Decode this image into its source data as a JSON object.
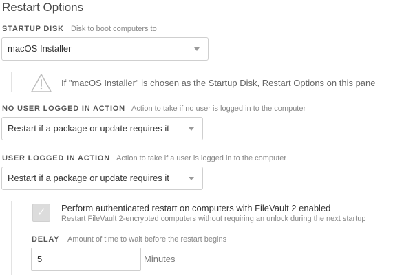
{
  "page": {
    "title": "Restart Options"
  },
  "startup_disk": {
    "label": "STARTUP DISK",
    "description": "Disk to boot computers to",
    "value": "macOS Installer"
  },
  "warning": {
    "icon": "warning-triangle-icon",
    "text": "If \"macOS Installer\" is chosen as the Startup Disk, Restart Options on this pane"
  },
  "no_user_action": {
    "label": "NO USER LOGGED IN ACTION",
    "description": "Action to take if no user is logged in to the computer",
    "value": "Restart if a package or update requires it"
  },
  "user_action": {
    "label": "USER LOGGED IN ACTION",
    "description": "Action to take if a user is logged in to the computer",
    "value": "Restart if a package or update requires it"
  },
  "auth_restart": {
    "checked": true,
    "check_glyph": "✓",
    "label": "Perform authenticated restart on computers with FileVault 2 enabled",
    "help": "Restart FileVault 2-encrypted computers without requiring an unlock during the next startup"
  },
  "delay": {
    "label": "DELAY",
    "description": "Amount of time to wait before the restart begins",
    "value": "5",
    "units": "Minutes"
  }
}
